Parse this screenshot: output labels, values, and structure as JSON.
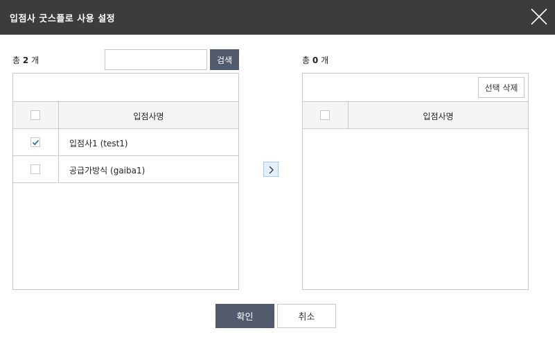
{
  "dialog": {
    "title": "입점사 굿스플로 사용 설정",
    "close_icon": "close-icon"
  },
  "left": {
    "count_prefix": "총",
    "count": "2",
    "count_suffix": "개",
    "search": {
      "value": "",
      "placeholder": "",
      "button_label": "검색"
    },
    "column_header": "입점사명",
    "rows": [
      {
        "name": "입점사1 (test1)",
        "checked": true
      },
      {
        "name": "공급가방식 (gaiba1)",
        "checked": false
      }
    ]
  },
  "move_button_icon": "chevron-right-icon",
  "right": {
    "count_prefix": "총",
    "count": "0",
    "count_suffix": "개",
    "delete_button_label": "선택 삭제",
    "column_header": "입점사명",
    "rows": []
  },
  "footer": {
    "confirm_label": "확인",
    "cancel_label": "취소"
  },
  "colors": {
    "header_bg": "#3c3c3c",
    "primary_button": "#525b6e",
    "check_color": "#2a6fad"
  }
}
